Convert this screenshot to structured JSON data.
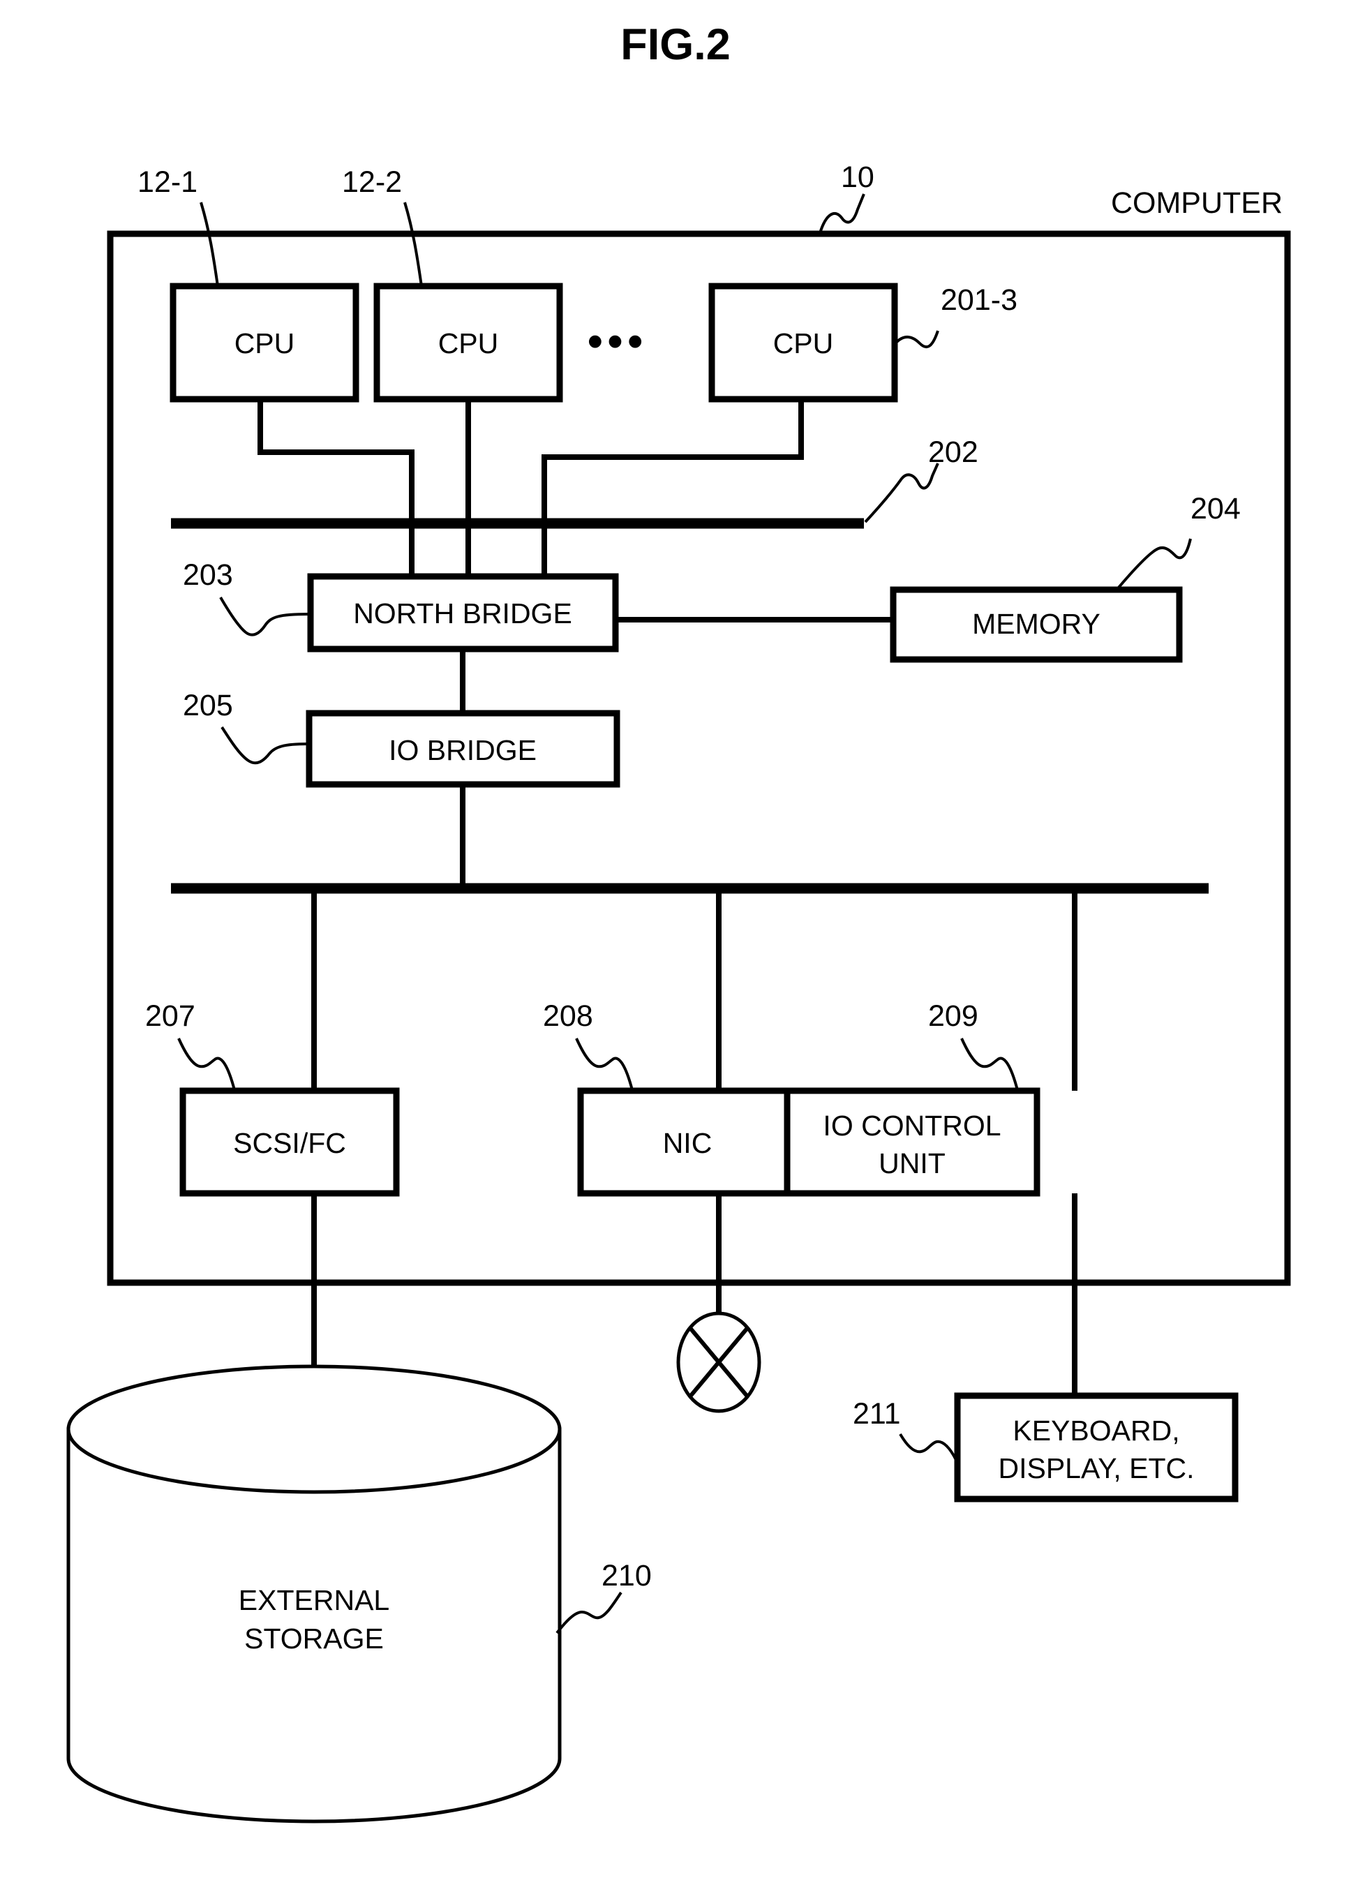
{
  "figure": {
    "title": "FIG.2",
    "outer_enclosure_label": "COMPUTER",
    "outer_enclosure_ref": "10"
  },
  "blocks": {
    "cpu1": {
      "label": "CPU",
      "ref": "12-1"
    },
    "cpu2": {
      "label": "CPU",
      "ref": "12-2"
    },
    "cpu3": {
      "label": "CPU",
      "ref": "201-3"
    },
    "ellipsis": "•••",
    "north_bridge": {
      "label": "NORTH BRIDGE",
      "ref": "203"
    },
    "memory": {
      "label": "MEMORY",
      "ref": "204"
    },
    "io_bridge": {
      "label": "IO BRIDGE",
      "ref": "205"
    },
    "scsi_fc": {
      "label": "SCSI/FC",
      "ref": "207"
    },
    "nic": {
      "label": "NIC",
      "ref": "208"
    },
    "io_control_unit": {
      "label_line1": "IO CONTROL",
      "label_line2": "UNIT",
      "ref": "209"
    },
    "external_storage": {
      "label_line1": "EXTERNAL",
      "label_line2": "STORAGE",
      "ref": "210"
    },
    "peripherals": {
      "label_line1": "KEYBOARD,",
      "label_line2": "DISPLAY, ETC.",
      "ref": "211"
    },
    "network_symbol": {
      "name": "network-cross-circle"
    }
  },
  "buses": {
    "cpu_bus_ref": "202",
    "io_bus_ref": ""
  }
}
